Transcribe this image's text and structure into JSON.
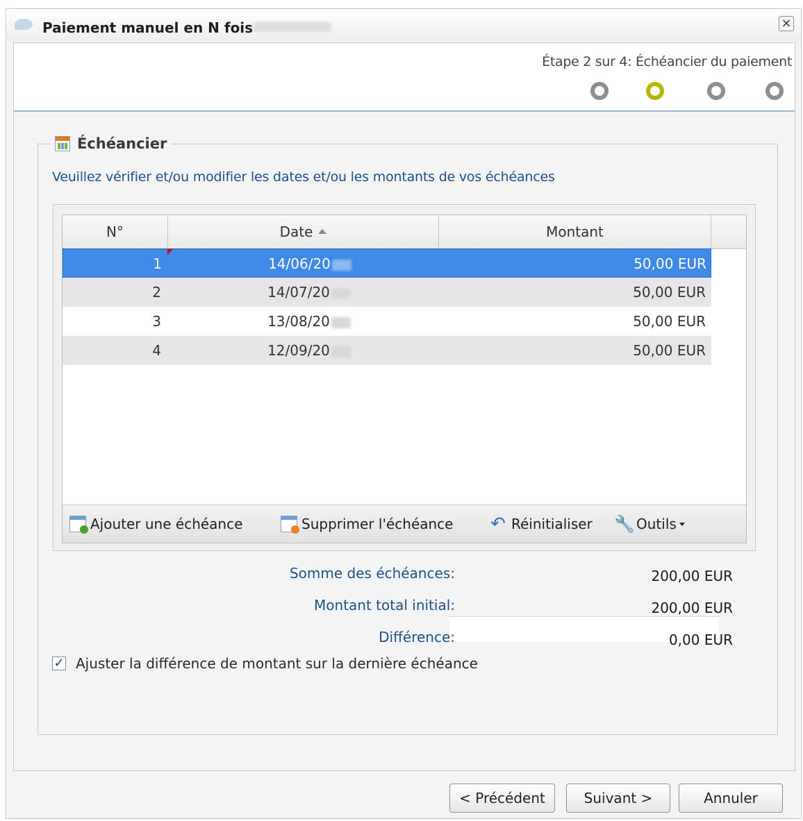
{
  "window": {
    "title": "Paiement manuel en N fois",
    "close_symbol": "×"
  },
  "step": {
    "text": "Étape 2 sur 4: Échéancier du paiement",
    "total": 4,
    "current": 2,
    "active_color": "#b5b800",
    "inactive_color": "#8e8e8e"
  },
  "section": {
    "legend": "Échéancier",
    "legend_icon": "calendar-icon",
    "instructions": "Veuillez vérifier et/ou modifier les dates et/ou les montants de vos échéances"
  },
  "grid": {
    "columns": [
      "N°",
      "Date",
      "Montant"
    ],
    "sorted_column": "Date",
    "rows": [
      {
        "no": "1",
        "date": "14/06/20",
        "amount": "50,00 EUR",
        "selected": true
      },
      {
        "no": "2",
        "date": "14/07/20",
        "amount": "50,00 EUR",
        "selected": false
      },
      {
        "no": "3",
        "date": "13/08/20",
        "amount": "50,00 EUR",
        "selected": false
      },
      {
        "no": "4",
        "date": "12/09/20",
        "amount": "50,00 EUR",
        "selected": false
      }
    ],
    "selected_color": "#3f8ae6"
  },
  "toolbar": {
    "add_label": "Ajouter une échéance",
    "add_icon": "calendar-add-icon",
    "delete_label": "Supprimer l'échéance",
    "delete_icon": "calendar-delete-icon",
    "reset_label": "Réinitialiser",
    "reset_icon": "undo-icon",
    "tools_label": "Outils",
    "tools_icon": "wrench-icon"
  },
  "totals": {
    "sum_label": "Somme des échéances:",
    "sum_value": "200,00 EUR",
    "initial_label": "Montant total initial:",
    "initial_value": "200,00 EUR",
    "diff_label": "Différence:",
    "diff_value": "0,00 EUR"
  },
  "options": {
    "adjust_label": "Ajuster la différence de montant sur la dernière échéance",
    "adjust_checked": true,
    "check_mark": "✓"
  },
  "buttons": {
    "previous": "< Précédent",
    "next": "Suivant >",
    "cancel": "Annuler"
  }
}
